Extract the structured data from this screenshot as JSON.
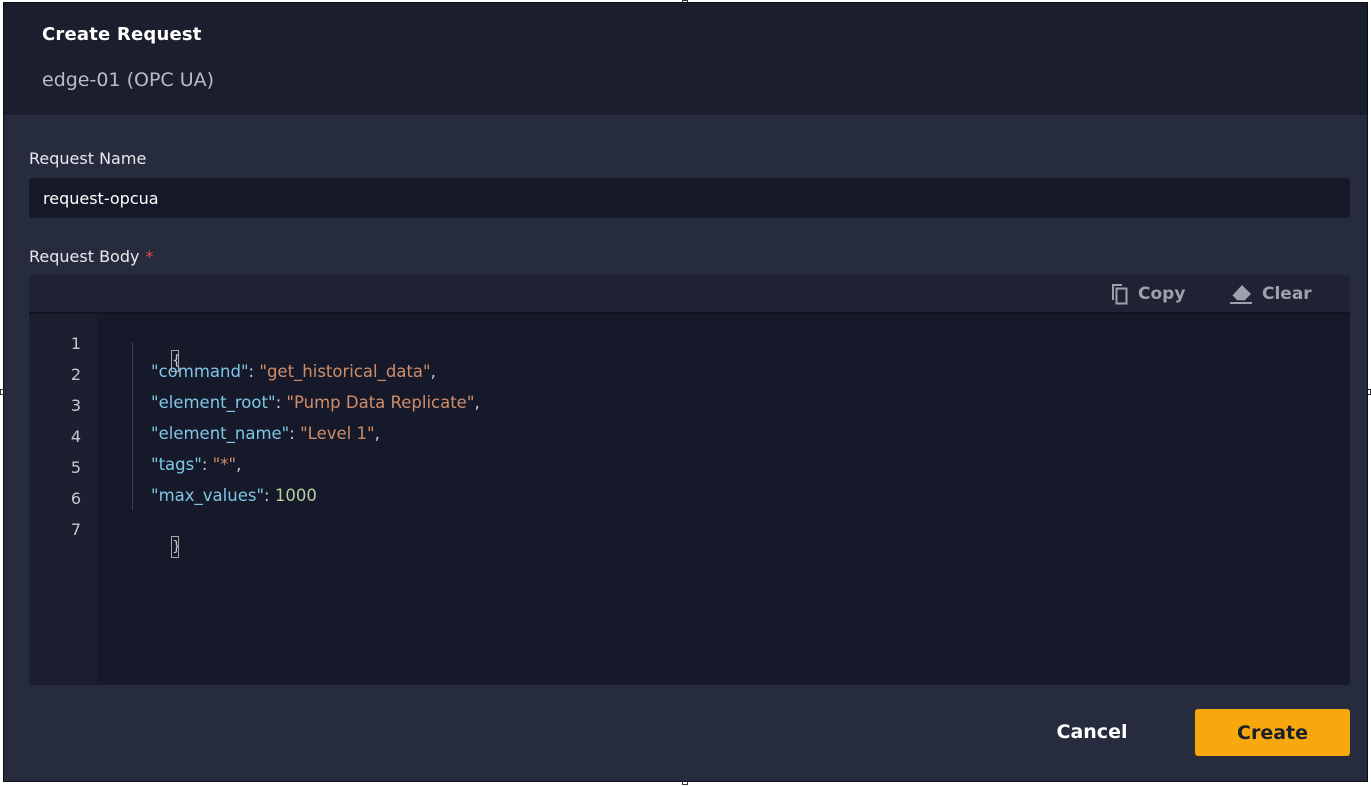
{
  "dialog": {
    "title": "Create Request",
    "subtitle": "edge-01 (OPC UA)"
  },
  "request_name": {
    "label": "Request Name",
    "value": "request-opcua"
  },
  "request_body": {
    "label": "Request Body",
    "required_marker": "*",
    "toolbar": {
      "copy_label": "Copy",
      "clear_label": "Clear"
    },
    "line_numbers": [
      "1",
      "2",
      "3",
      "4",
      "5",
      "6",
      "7"
    ],
    "code": {
      "open_brace": "{",
      "close_brace": "}",
      "lines": [
        {
          "key": "\"command\"",
          "sep": ": ",
          "value": "\"get_historical_data\"",
          "end": ","
        },
        {
          "key": "\"element_root\"",
          "sep": ": ",
          "value": "\"Pump Data Replicate\"",
          "end": ","
        },
        {
          "key": "\"element_name\"",
          "sep": ": ",
          "value": "\"Level 1\"",
          "end": ","
        },
        {
          "key": "\"tags\"",
          "sep": ": ",
          "value": "\"*\"",
          "end": ","
        },
        {
          "key": "\"max_values\"",
          "sep": ": ",
          "value": "1000",
          "end": ""
        }
      ]
    }
  },
  "actions": {
    "cancel_label": "Cancel",
    "create_label": "Create"
  },
  "colors": {
    "accent": "#f7a80c",
    "json_key": "#7fc6e8",
    "json_string": "#d08d6a",
    "json_number": "#b8cfa0",
    "required": "#e5484d"
  },
  "icons": {
    "copy": "copy-icon",
    "clear": "eraser-icon"
  }
}
